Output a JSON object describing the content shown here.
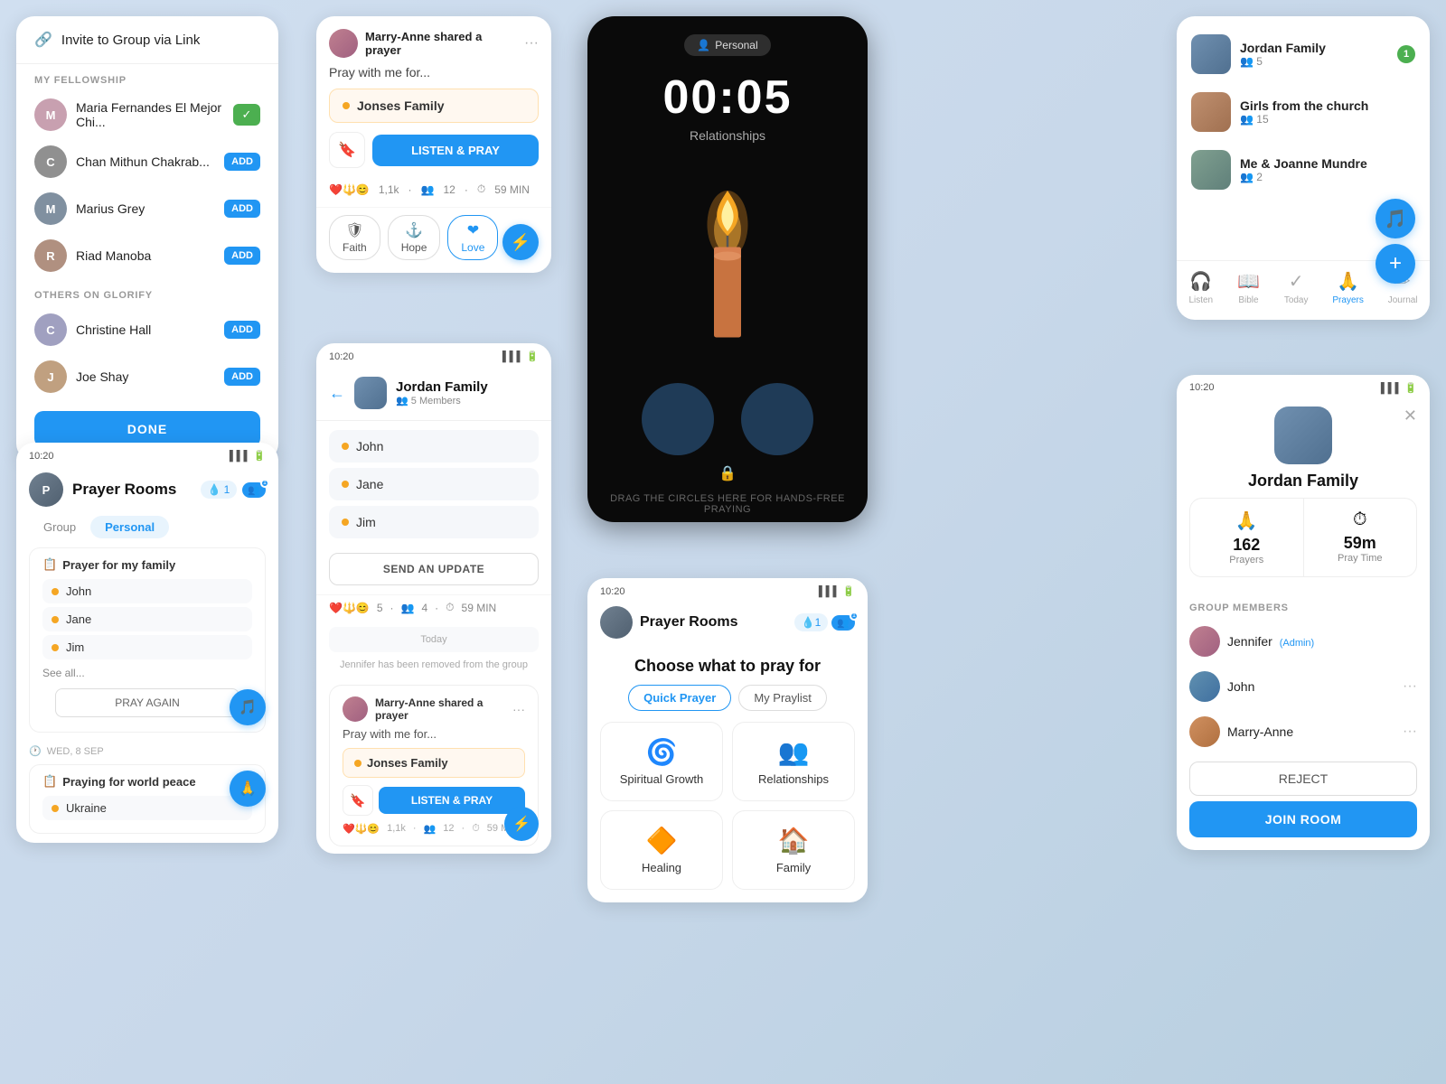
{
  "invite_card": {
    "invite_btn_label": "Invite to Group via Link",
    "my_fellowship_label": "MY FELLOWSHIP",
    "others_label": "OTHERS ON GLORIFY",
    "done_label": "DONE",
    "members": [
      {
        "name": "Maria Fernandes El Mejor Chi...",
        "status": "check",
        "av": "av1"
      },
      {
        "name": "Chan Mithun Chakrab...",
        "status": "add",
        "av": "av2"
      },
      {
        "name": "Marius Grey",
        "status": "add",
        "av": "av3"
      },
      {
        "name": "Riad Manoba",
        "status": "add",
        "av": "av4"
      }
    ],
    "others": [
      {
        "name": "Christine Hall",
        "status": "add",
        "av": "av5"
      },
      {
        "name": "Joe Shay",
        "status": "add",
        "av": "av6"
      }
    ]
  },
  "prayer_rooms_card": {
    "time": "10:20",
    "title": "Prayer Rooms",
    "drop_count": "1",
    "tab_group": "Group",
    "tab_personal": "Personal",
    "prayer_item": {
      "title": "Prayer for my family",
      "members": [
        "John",
        "Jane",
        "Jim"
      ],
      "see_all": "See all...",
      "pray_again": "PRAY AGAIN"
    },
    "date_label": "WED, 8 SEP",
    "prayer_item2_title": "Praying for world peace",
    "prayer_item2_sub": "Ukraine"
  },
  "prayer_share_card": {
    "sharer": "Marry-Anne shared a prayer",
    "pray_with": "Pray with me for...",
    "family": "Jonses Family",
    "listen_pray": "LISTEN & PRAY",
    "stats": {
      "reactions": "1,1k",
      "people": "12",
      "duration": "59 MIN"
    },
    "tags": [
      {
        "label": "Faith",
        "icon": "🛡"
      },
      {
        "label": "Hope",
        "icon": "⚓"
      },
      {
        "label": "Love",
        "icon": "❤"
      }
    ]
  },
  "jordan_chat": {
    "time": "10:20",
    "title": "Jordan Family",
    "subtitle": "5 Members",
    "members": [
      "John",
      "Jane",
      "Jim"
    ],
    "send_update": "SEND AN UPDATE",
    "stats": {
      "hearts": "5",
      "people": "4",
      "duration": "59 MIN"
    },
    "today_label": "Today",
    "system_msg": "Jennifer has been removed from the group",
    "sharer": "Marry-Anne shared a prayer",
    "pray_with": "Pray with me for...",
    "family": "Jonses Family",
    "listen_pray": "LISTEN & PRAY",
    "stats2": {
      "reactions": "1,1k",
      "people": "12",
      "duration": "59 MI"
    }
  },
  "candle_card": {
    "badge": "Personal",
    "timer": "00:05",
    "label": "Relationships",
    "drag_hint": "DRAG THE CIRCLES HERE\nFOR HANDS-FREE PRAYING"
  },
  "choose_pray_card": {
    "time": "10:20",
    "title": "Prayer Rooms",
    "heading": "Choose what to pray for",
    "tab_quick": "Quick Prayer",
    "tab_my": "My Praylist",
    "categories": [
      {
        "icon": "🌀",
        "label": "Spiritual Growth"
      },
      {
        "icon": "👥",
        "label": "Relationships"
      },
      {
        "icon": "🔶",
        "label": "Healing"
      },
      {
        "icon": "🏠",
        "label": "Family"
      }
    ]
  },
  "groups_card": {
    "groups": [
      {
        "name": "Jordan Family",
        "members": "5",
        "notif": "1",
        "av": "av-group1"
      },
      {
        "name": "Girls from the church",
        "members": "15",
        "notif": null,
        "av": "av-group2"
      },
      {
        "name": "Me & Joanne Mundre",
        "members": "2",
        "notif": null,
        "av": "av-group3"
      }
    ],
    "nav": [
      {
        "label": "Listen",
        "icon": "🎧",
        "active": false
      },
      {
        "label": "Bible",
        "icon": "📖",
        "active": false
      },
      {
        "label": "Today",
        "icon": "✓",
        "active": false
      },
      {
        "label": "Prayers",
        "icon": "🙏",
        "active": true
      },
      {
        "label": "Journal",
        "icon": "✏",
        "active": false
      }
    ]
  },
  "jordan_detail": {
    "time": "10:20",
    "name": "Jordan Family",
    "stats": [
      {
        "icon": "🙏",
        "value": "162",
        "label": "Prayers"
      },
      {
        "icon": "⏱",
        "value": "59m",
        "label": "Pray Time"
      }
    ],
    "members_label": "GROUP MEMBERS",
    "members": [
      {
        "name": "Jennifer",
        "admin": true,
        "av": "av-pink"
      },
      {
        "name": "John",
        "admin": false,
        "av": "av-blue"
      },
      {
        "name": "Marry-Anne",
        "admin": false,
        "av": "av-orange"
      }
    ],
    "reject_label": "REJECT",
    "join_label": "JOIN ROOM"
  }
}
